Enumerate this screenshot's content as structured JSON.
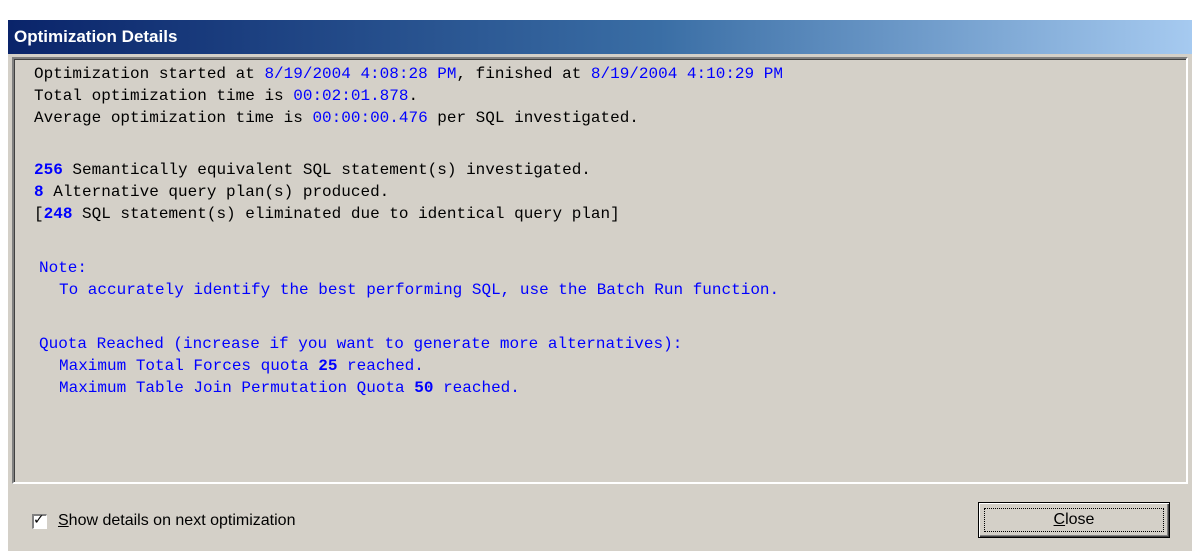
{
  "window": {
    "title": "Optimization Details"
  },
  "details": {
    "line1": {
      "prefix": "Optimization started at ",
      "started": "8/19/2004 4:08:28 PM",
      "middle": ", finished at ",
      "finished": "8/19/2004 4:10:29 PM"
    },
    "line2": {
      "prefix": "Total optimization time is ",
      "total_time": "00:02:01.878",
      "suffix": "."
    },
    "line3": {
      "prefix": "Average optimization time is ",
      "avg_time": "00:00:00.476",
      "suffix": " per SQL investigated."
    },
    "line4": {
      "count": "256",
      "text": " Semantically equivalent SQL statement(s) investigated."
    },
    "line5": {
      "count": "8",
      "text": " Alternative query plan(s) produced."
    },
    "line6": {
      "open": "[",
      "count": "248",
      "text": " SQL statement(s) eliminated due to identical query plan]"
    },
    "note": {
      "heading": "Note:",
      "text": "To accurately identify the best performing SQL, use the Batch Run function."
    },
    "quota": {
      "heading": "Quota Reached (increase if you want to generate more alternatives):",
      "forces_prefix": "Maximum Total Forces quota ",
      "forces_value": "25",
      "forces_suffix": " reached.",
      "join_prefix": "Maximum Table Join Permutation Quota ",
      "join_value": "50",
      "join_suffix": " reached."
    }
  },
  "footer": {
    "checkbox_label_underlined": "S",
    "checkbox_label_rest": "how details on next optimization",
    "checkbox_checked": true,
    "close_underlined": "C",
    "close_rest": "lose"
  }
}
